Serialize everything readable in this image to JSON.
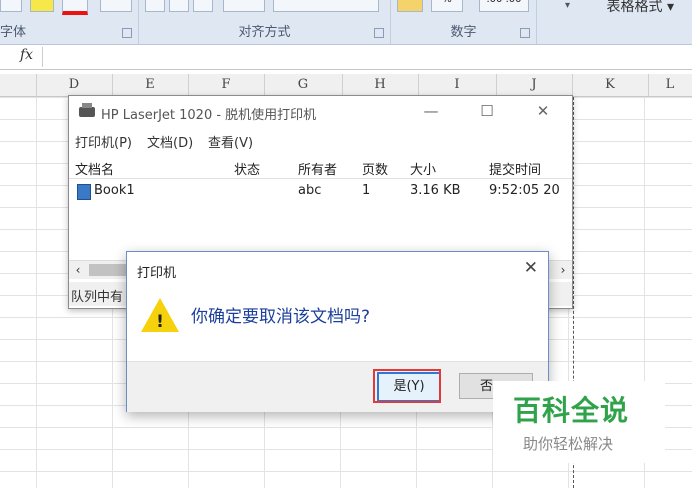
{
  "ribbon": {
    "group_font": "字体",
    "group_align": "对齐方式",
    "group_number": "数字",
    "number_format_left": "%",
    "number_format_right": ".00 .00",
    "table_format": "表格格式"
  },
  "formula_bar": {
    "fx": "fx"
  },
  "columns": [
    "D",
    "E",
    "F",
    "G",
    "H",
    "I",
    "J",
    "K",
    "L"
  ],
  "print_queue": {
    "title": "HP LaserJet 1020 - 脱机使用打印机",
    "menu": [
      "打印机(P)",
      "文档(D)",
      "查看(V)"
    ],
    "headers": [
      "文档名",
      "状态",
      "所有者",
      "页数",
      "大小",
      "提交时间"
    ],
    "row": {
      "name": "Book1",
      "status": "",
      "owner": "abc",
      "pages": "1",
      "size": "3.16 KB",
      "time": "9:52:05 20"
    },
    "status_text": "队列中有"
  },
  "dialog": {
    "title": "打印机",
    "message": "你确定要取消该文档吗?",
    "yes_label": "是(Y)",
    "no_label": "否"
  },
  "watermark": {
    "main": "百科全说",
    "sub": "助你轻松解决"
  },
  "colors": {
    "accent": "#2f78d6",
    "highlight": "#e23a3a",
    "warning": "#f5d20c",
    "brand": "#2fa24a"
  }
}
